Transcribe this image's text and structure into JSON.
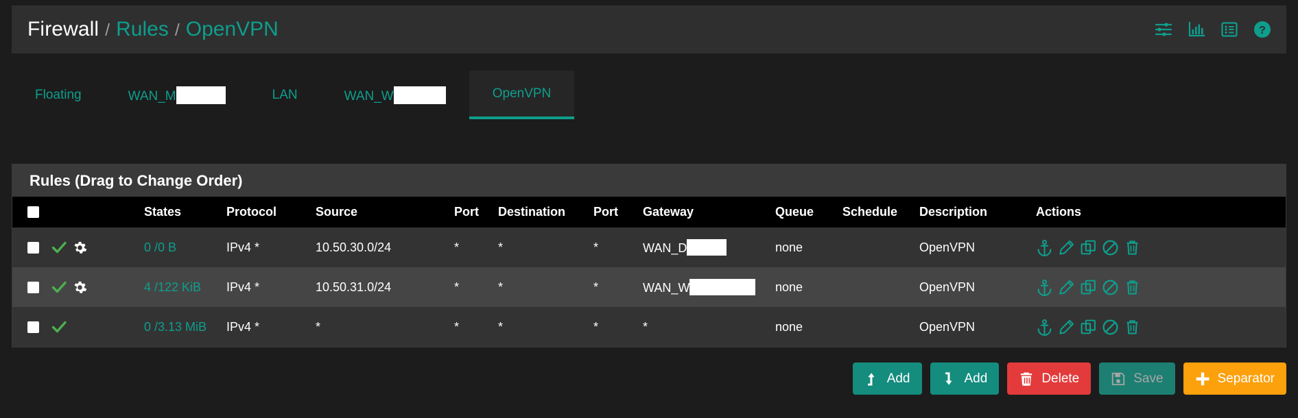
{
  "header": {
    "breadcrumb": {
      "root": "Firewall",
      "sep": "/",
      "section": "Rules",
      "current": "OpenVPN"
    },
    "icons": [
      {
        "name": "sliders-icon",
        "label": "Advanced settings"
      },
      {
        "name": "chart-icon",
        "label": "Statistics"
      },
      {
        "name": "list-icon",
        "label": "Rule list"
      },
      {
        "name": "help-icon",
        "label": "Help"
      }
    ],
    "accent_color": "#0e9e8d",
    "background_color": "#2f2f2f"
  },
  "tabs": [
    {
      "label": "Floating",
      "redacted": false,
      "redact_width": 0,
      "active": false
    },
    {
      "label": "WAN_M",
      "redacted": true,
      "redact_width": 72,
      "active": false
    },
    {
      "label": "LAN",
      "redacted": false,
      "redact_width": 0,
      "active": false
    },
    {
      "label": "WAN_W",
      "redacted": true,
      "redact_width": 76,
      "active": false
    },
    {
      "label": "OpenVPN",
      "redacted": false,
      "redact_width": 0,
      "active": true
    }
  ],
  "panel": {
    "title": "Rules (Drag to Change Order)",
    "columns": [
      "",
      "",
      "States",
      "Protocol",
      "Source",
      "Port",
      "Destination",
      "Port",
      "Gateway",
      "Queue",
      "Schedule",
      "Description",
      "Actions"
    ],
    "column_labels": {
      "states": "States",
      "protocol": "Protocol",
      "source": "Source",
      "source_port": "Port",
      "destination": "Destination",
      "destination_port": "Port",
      "gateway": "Gateway",
      "queue": "Queue",
      "schedule": "Schedule",
      "description": "Description",
      "actions": "Actions"
    },
    "rows": [
      {
        "selected": false,
        "status_icons": [
          "check-icon",
          "gear-icon"
        ],
        "states": "0 /0 B",
        "protocol": "IPv4 *",
        "source": "10.50.30.0/24",
        "source_port": "*",
        "destination": "*",
        "destination_port": "*",
        "gateway": "WAN_D",
        "gateway_redacted": true,
        "gateway_redact_width": 58,
        "queue": "none",
        "schedule": "",
        "description": "OpenVPN",
        "actions": [
          "anchor-icon",
          "edit-icon",
          "copy-icon",
          "block-icon",
          "delete-icon"
        ]
      },
      {
        "selected": false,
        "status_icons": [
          "check-icon",
          "gear-icon"
        ],
        "states": "4 /122 KiB",
        "protocol": "IPv4 *",
        "source": "10.50.31.0/24",
        "source_port": "*",
        "destination": "*",
        "destination_port": "*",
        "gateway": "WAN_W",
        "gateway_redacted": true,
        "gateway_redact_width": 96,
        "queue": "none",
        "schedule": "",
        "description": "OpenVPN",
        "actions": [
          "anchor-icon",
          "edit-icon",
          "copy-icon",
          "block-icon",
          "delete-icon"
        ]
      },
      {
        "selected": false,
        "status_icons": [
          "check-icon"
        ],
        "states": "0 /3.13 MiB",
        "protocol": "IPv4 *",
        "source": "*",
        "source_port": "*",
        "destination": "*",
        "destination_port": "*",
        "gateway": "*",
        "gateway_redacted": false,
        "gateway_redact_width": 0,
        "queue": "none",
        "schedule": "",
        "description": "OpenVPN",
        "actions": [
          "anchor-icon",
          "edit-icon",
          "copy-icon",
          "block-icon",
          "delete-icon"
        ]
      }
    ]
  },
  "footer": {
    "buttons": [
      {
        "name": "add-up-button",
        "label": "Add",
        "icon": "arrow-up-icon",
        "style": "teal",
        "disabled": false
      },
      {
        "name": "add-down-button",
        "label": "Add",
        "icon": "arrow-down-icon",
        "style": "teal",
        "disabled": false
      },
      {
        "name": "delete-button",
        "label": "Delete",
        "icon": "trash-icon",
        "style": "red",
        "disabled": false
      },
      {
        "name": "save-button",
        "label": "Save",
        "icon": "save-icon",
        "style": "save",
        "disabled": true
      },
      {
        "name": "separator-button",
        "label": "Separator",
        "icon": "plus-icon",
        "style": "orange",
        "disabled": false
      }
    ]
  },
  "colors": {
    "accent": "#0e9e8d",
    "danger": "#e33b3b",
    "warning": "#fca00c",
    "success": "#4caf50",
    "row_odd": "#333333",
    "row_even": "#454545",
    "page_bg": "#1c1c1c"
  }
}
